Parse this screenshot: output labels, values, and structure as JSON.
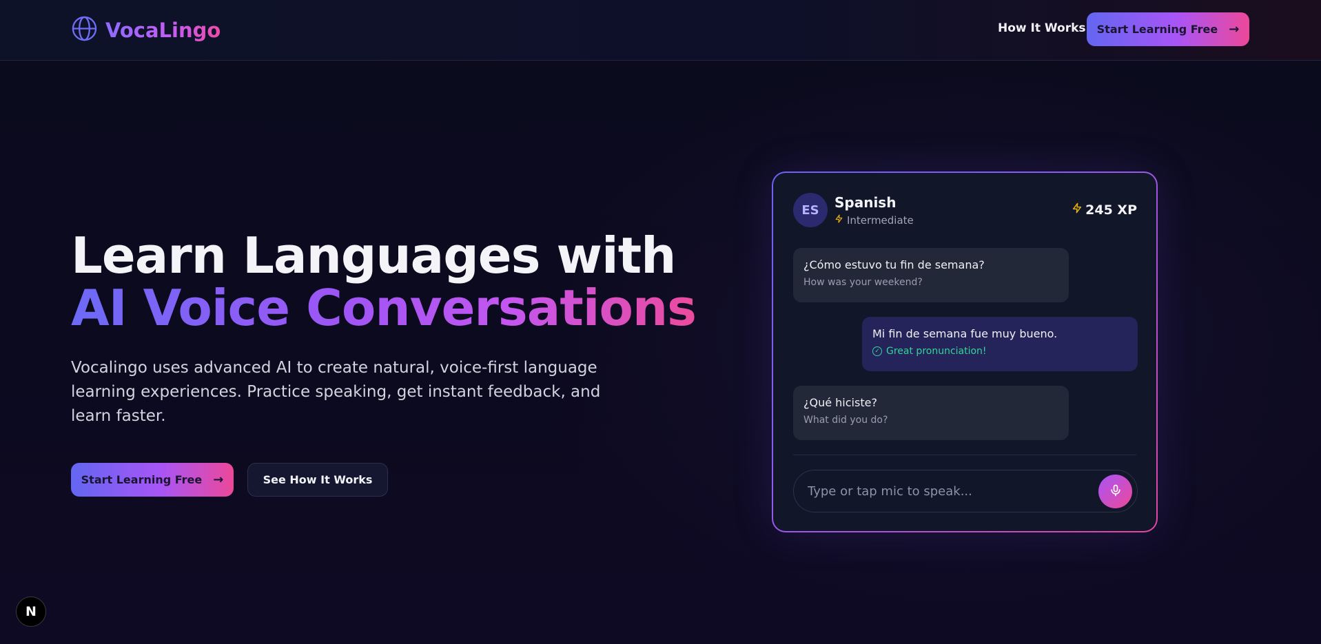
{
  "header": {
    "brand": "VocaLingo",
    "nav_how_it_works": "How It Works",
    "cta_label": "Start Learning Free"
  },
  "hero": {
    "title_line1": "Learn Languages with",
    "title_line2": "AI Voice Conversations",
    "description": "Vocalingo uses advanced AI to create natural, voice-first language learning experiences. Practice speaking, get instant feedback, and learn faster.",
    "primary_cta": "Start Learning Free",
    "secondary_cta": "See How It Works"
  },
  "chat": {
    "avatar": "ES",
    "language": "Spanish",
    "level": "Intermediate",
    "xp": "245 XP",
    "messages": [
      {
        "role": "ai",
        "text": "¿Cómo estuvo tu fin de semana?",
        "translation": "How was your weekend?"
      },
      {
        "role": "user",
        "text": "Mi fin de semana fue muy bueno.",
        "feedback": "Great pronunciation!"
      },
      {
        "role": "ai",
        "text": "¿Qué hiciste?",
        "translation": "What did you do?"
      }
    ],
    "input_placeholder": "Type or tap mic to speak..."
  },
  "badge": {
    "label": "N"
  },
  "colors": {
    "accent_start": "#6366f1",
    "accent_mid": "#a855f7",
    "accent_end": "#ec4899",
    "xp_bolt": "#eab308",
    "success": "#34d399"
  },
  "icons": {
    "logo": "globe-icon",
    "arrow": "arrow-right-icon",
    "bolt": "lightning-icon",
    "check": "check-circle-icon",
    "mic": "microphone-icon"
  }
}
